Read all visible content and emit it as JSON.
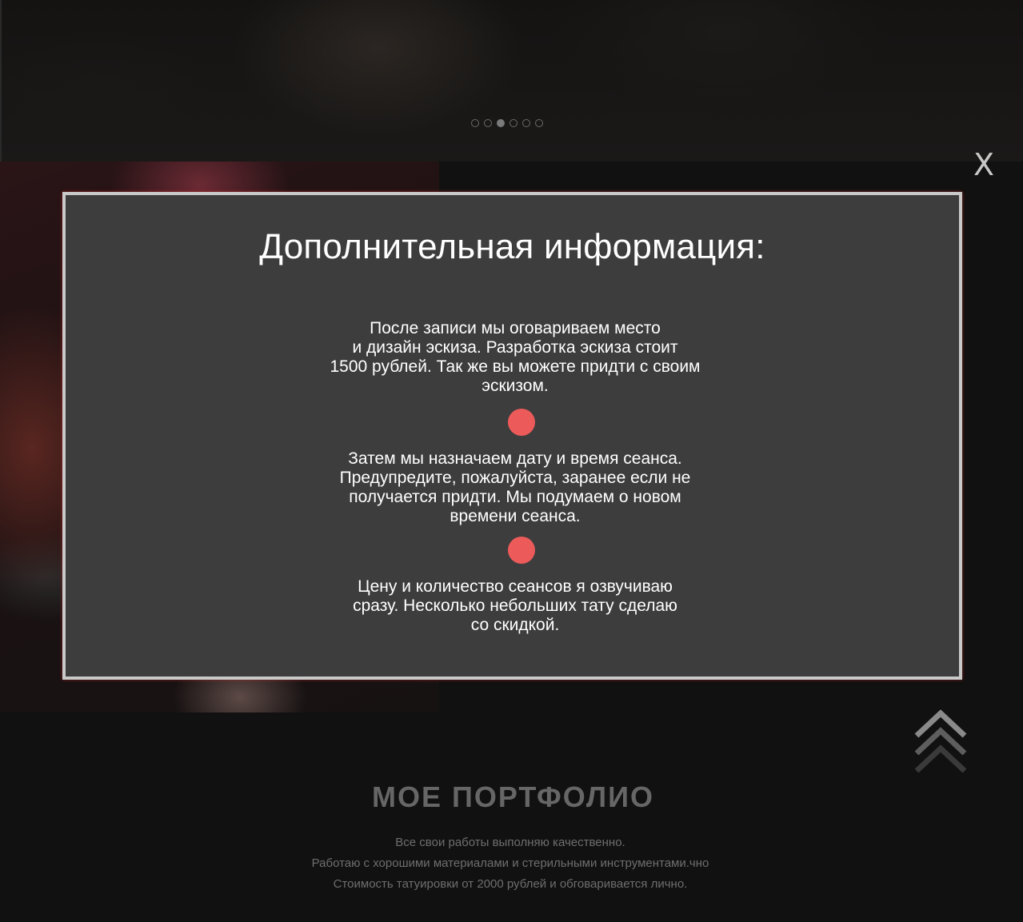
{
  "hero": {
    "slider_dots": [
      {
        "active": false
      },
      {
        "active": false
      },
      {
        "active": true
      },
      {
        "active": false
      },
      {
        "active": false
      },
      {
        "active": false
      }
    ]
  },
  "modal": {
    "close_label": "X",
    "title": "Дополнительная информация:",
    "steps": [
      {
        "lines": [
          "После записи мы оговариваем место",
          "и дизайн эскиза. Разработка эскиза стоит",
          "1500 рублей. Так же вы можете придти с своим",
          "эскизом."
        ]
      },
      {
        "lines": [
          "Затем мы назначаем дату и время сеанса.",
          "Предупредите, пожалуйста, заранее если не",
          "получается придти. Мы подумаем о новом",
          "времени сеанса."
        ]
      },
      {
        "lines": [
          "Цену и количество сеансов я озвучиваю",
          "сразу. Несколько небольших тату сделаю",
          "со скидкой."
        ]
      }
    ],
    "marker_color": "#ec5a5a"
  },
  "scroll_up": {
    "icon": "chevron-triple-up-icon"
  },
  "portfolio": {
    "title": "МОЕ ПОРТФОЛИО",
    "lines": [
      "Все свои работы выполняю качественно.",
      "Работаю с хорошими материалами и стерильными инструментами.чно",
      "Стоимость татуировки от 2000 рублей и обговаривается лично."
    ]
  }
}
